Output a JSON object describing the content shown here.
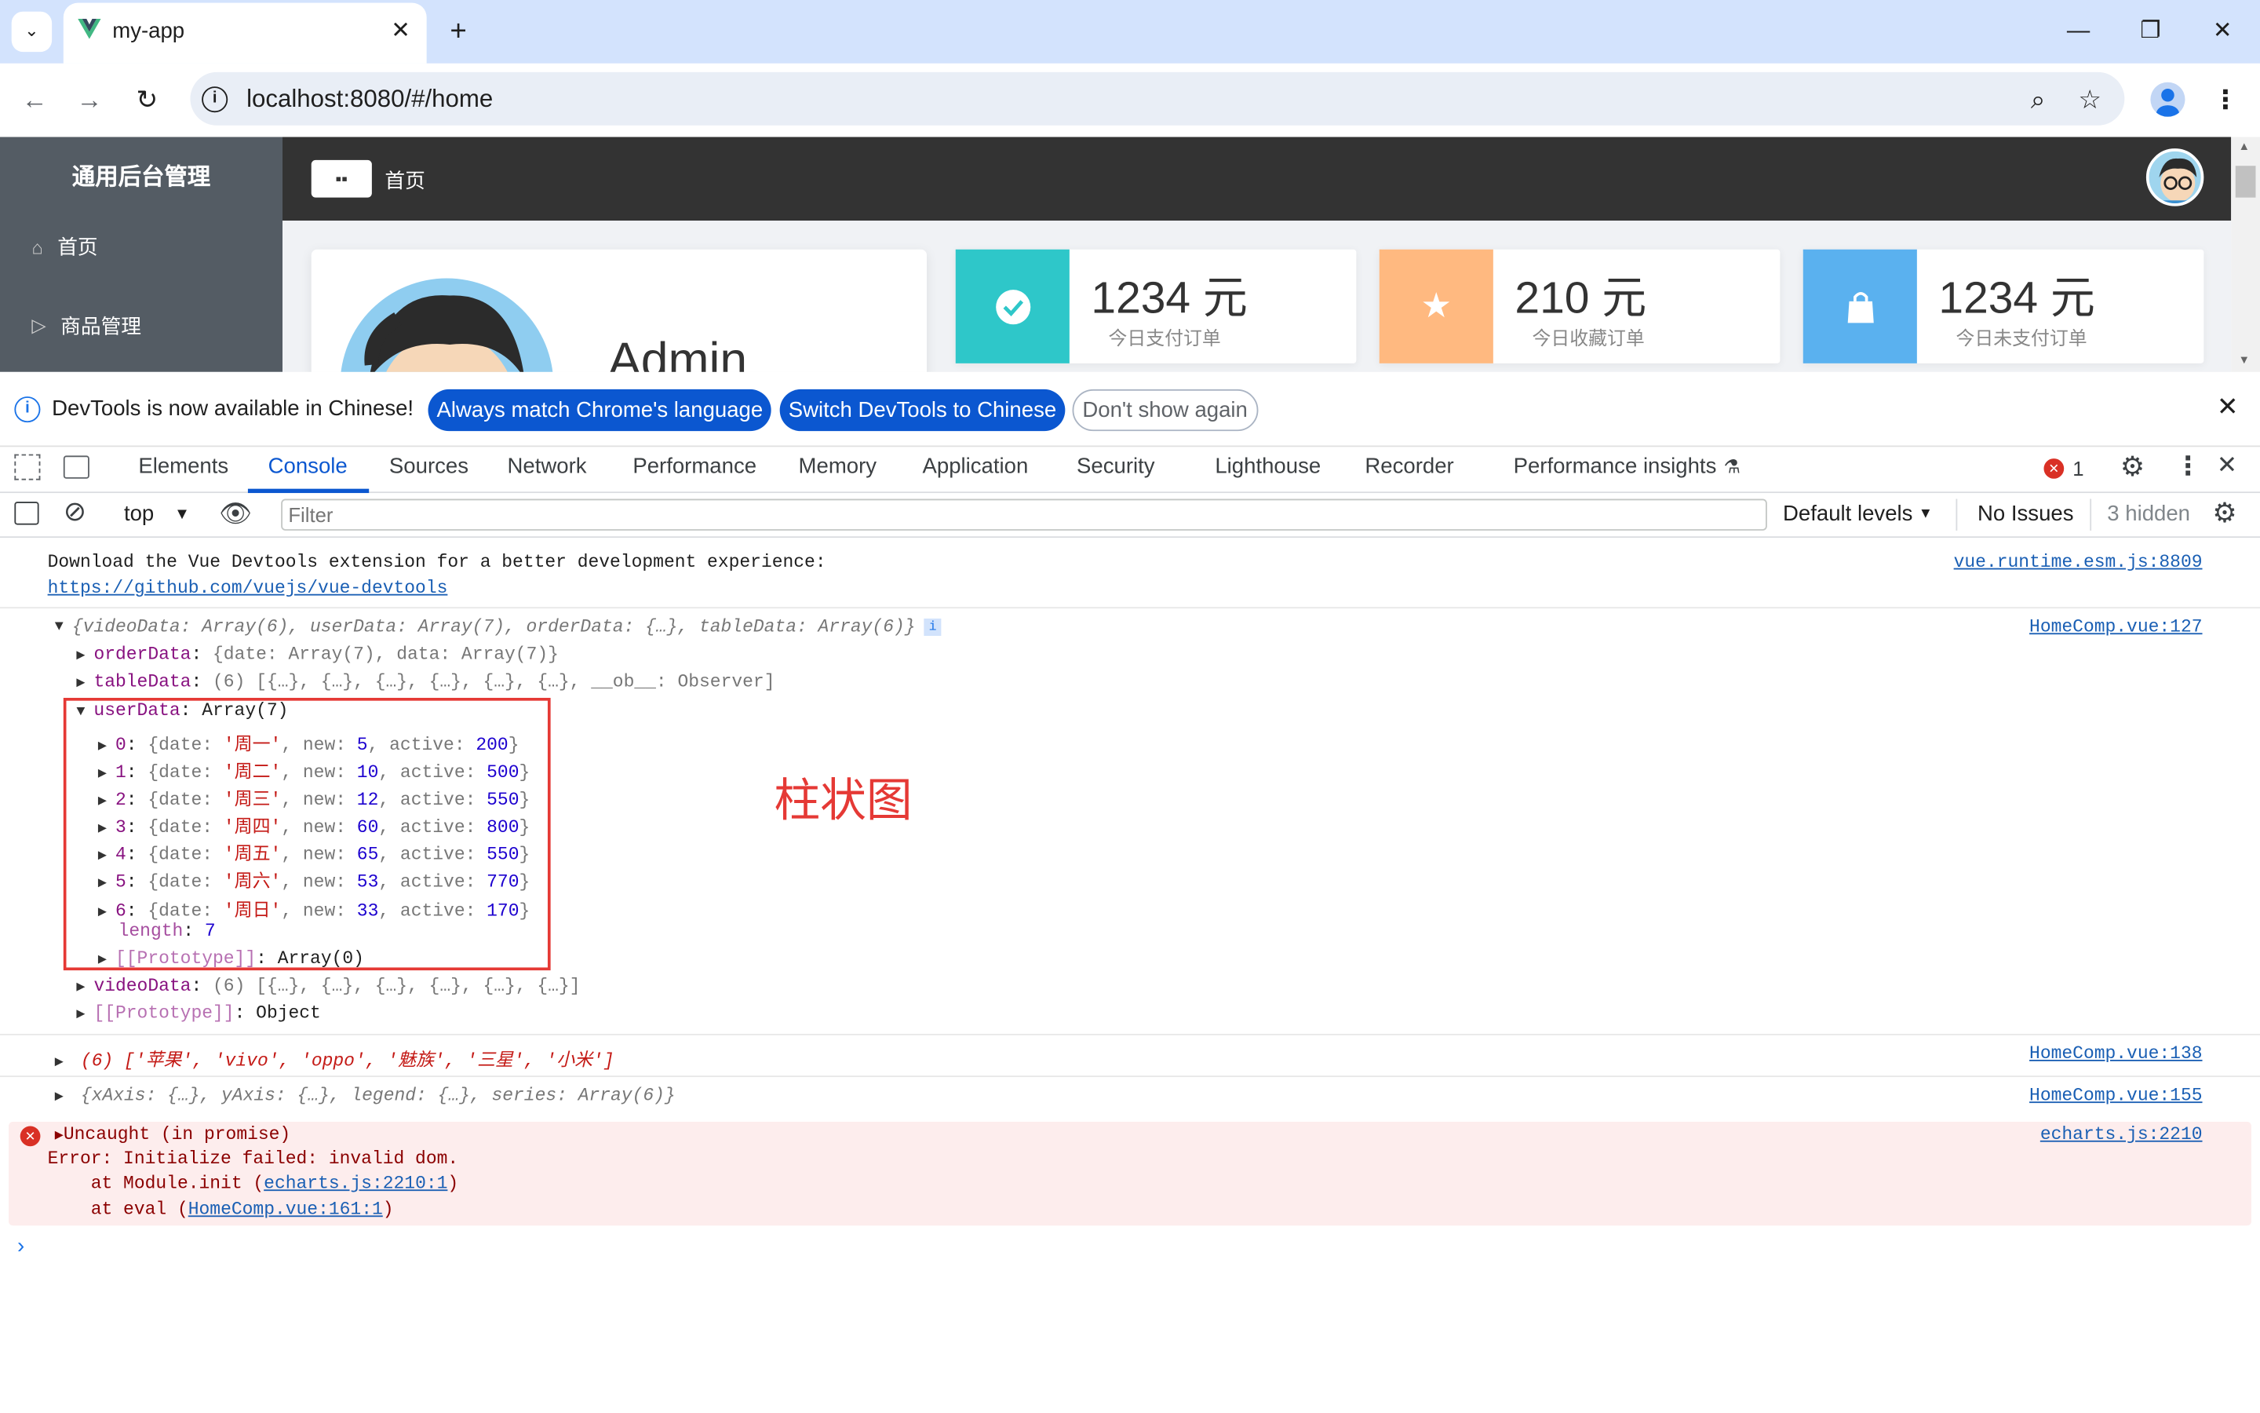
{
  "browser": {
    "tab_title": "my-app",
    "url": "localhost:8080/#/home"
  },
  "app": {
    "aside_title": "通用后台管理",
    "aside_items": [
      "首页",
      "商品管理"
    ],
    "breadcrumb": "首页",
    "user_name": "Admin",
    "stats": [
      {
        "value": "1234 元",
        "label": "今日支付订单",
        "color": "#2ec7c9",
        "icon": "check-circle-icon"
      },
      {
        "value": "210 元",
        "label": "今日收藏订单",
        "color": "#ffb980",
        "icon": "star-icon"
      },
      {
        "value": "1234 元",
        "label": "今日未支付订单",
        "color": "#5ab1ef",
        "icon": "shopping-bag-icon"
      }
    ]
  },
  "devtools": {
    "infobar_text": "DevTools is now available in Chinese!",
    "btn_match": "Always match Chrome's language",
    "btn_switch": "Switch DevTools to Chinese",
    "btn_dont_show": "Don't show again",
    "tabs": [
      "Elements",
      "Console",
      "Sources",
      "Network",
      "Performance",
      "Memory",
      "Application",
      "Security",
      "Lighthouse",
      "Recorder",
      "Performance insights"
    ],
    "active_tab": "Console",
    "error_count": "1",
    "context": "top",
    "filter_placeholder": "Filter",
    "levels": "Default levels",
    "issues": "No Issues",
    "hidden": "3 hidden"
  },
  "console": {
    "vue_msg": "Download the Vue Devtools extension for a better development experience:",
    "vue_link": "https://github.com/vuejs/vue-devtools",
    "vue_src": "vue.runtime.esm.js:8809",
    "obj_summary": "{videoData: Array(6), userData: Array(7), orderData: {…}, tableData: Array(6)}",
    "obj_src": "HomeComp.vue:127",
    "orderData": "{date: Array(7), data: Array(7)}",
    "tableData": "(6) [{…}, {…}, {…}, {…}, {…}, {…}, __ob__: Observer]",
    "userData_label": "Array(7)",
    "userData": [
      {
        "idx": "0",
        "date": "'周一'",
        "new": "5",
        "active": "200"
      },
      {
        "idx": "1",
        "date": "'周二'",
        "new": "10",
        "active": "500"
      },
      {
        "idx": "2",
        "date": "'周三'",
        "new": "12",
        "active": "550"
      },
      {
        "idx": "3",
        "date": "'周四'",
        "new": "60",
        "active": "800"
      },
      {
        "idx": "4",
        "date": "'周五'",
        "new": "65",
        "active": "550"
      },
      {
        "idx": "5",
        "date": "'周六'",
        "new": "53",
        "active": "770"
      },
      {
        "idx": "6",
        "date": "'周日'",
        "new": "33",
        "active": "170"
      }
    ],
    "length": "7",
    "proto_array": "Array(0)",
    "videoData": "(6) [{…}, {…}, {…}, {…}, {…}, {…}]",
    "proto_object": "Object",
    "brands": "(6) ['苹果', 'vivo', 'oppo', '魅族', '三星', '小米']",
    "brands_src": "HomeComp.vue:138",
    "echarts_opts": "{xAxis: {…}, yAxis: {…}, legend: {…}, series: Array(6)}",
    "echarts_src": "HomeComp.vue:155",
    "err_title": "Uncaught (in promise)",
    "err_msg": "Error: Initialize failed: invalid dom.",
    "err_at1_pre": "    at Module.init (",
    "err_at1_link": "echarts.js:2210:1",
    "err_at2_pre": "    at eval (",
    "err_at2_link": "HomeComp.vue:161:1",
    "err_src": "echarts.js:2210"
  },
  "annotation": "柱状图"
}
